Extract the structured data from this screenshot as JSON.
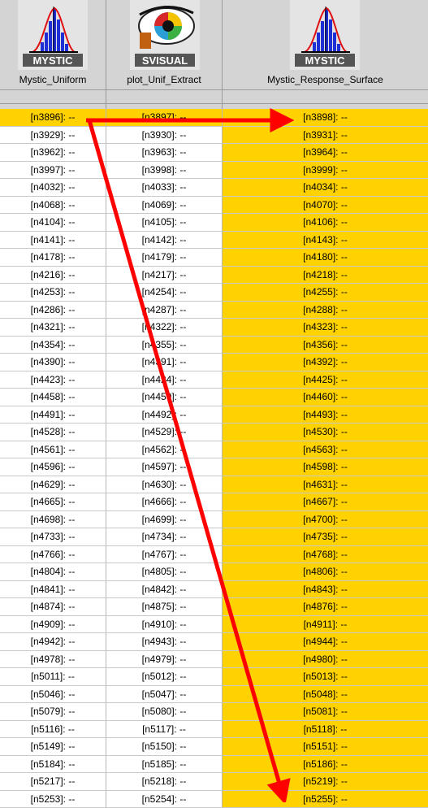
{
  "columns": [
    {
      "name": "Mystic_Uniform",
      "icon": "mystic-histogram-icon",
      "icon_label": "MYSTIC"
    },
    {
      "name": "plot_Unif_Extract",
      "icon": "visual-eye-icon",
      "icon_label": "SVISUAL"
    },
    {
      "name": "Mystic_Response_Surface",
      "icon": "mystic-histogram-icon",
      "icon_label": "MYSTIC"
    }
  ],
  "rows": [
    [
      "[n3896]: --",
      "[n3897]: --",
      "[n3898]: --"
    ],
    [
      "[n3929]: --",
      "[n3930]: --",
      "[n3931]: --"
    ],
    [
      "[n3962]: --",
      "[n3963]: --",
      "[n3964]: --"
    ],
    [
      "[n3997]: --",
      "[n3998]: --",
      "[n3999]: --"
    ],
    [
      "[n4032]: --",
      "[n4033]: --",
      "[n4034]: --"
    ],
    [
      "[n4068]: --",
      "[n4069]: --",
      "[n4070]: --"
    ],
    [
      "[n4104]: --",
      "[n4105]: --",
      "[n4106]: --"
    ],
    [
      "[n4141]: --",
      "[n4142]: --",
      "[n4143]: --"
    ],
    [
      "[n4178]: --",
      "[n4179]: --",
      "[n4180]: --"
    ],
    [
      "[n4216]: --",
      "[n4217]: --",
      "[n4218]: --"
    ],
    [
      "[n4253]: --",
      "[n4254]: --",
      "[n4255]: --"
    ],
    [
      "[n4286]: --",
      "[n4287]: --",
      "[n4288]: --"
    ],
    [
      "[n4321]: --",
      "[n4322]: --",
      "[n4323]: --"
    ],
    [
      "[n4354]: --",
      "[n4355]: --",
      "[n4356]: --"
    ],
    [
      "[n4390]: --",
      "[n4391]: --",
      "[n4392]: --"
    ],
    [
      "[n4423]: --",
      "[n4424]: --",
      "[n4425]: --"
    ],
    [
      "[n4458]: --",
      "[n4459]: --",
      "[n4460]: --"
    ],
    [
      "[n4491]: --",
      "[n4492]: --",
      "[n4493]: --"
    ],
    [
      "[n4528]: --",
      "[n4529]: --",
      "[n4530]: --"
    ],
    [
      "[n4561]: --",
      "[n4562]: --",
      "[n4563]: --"
    ],
    [
      "[n4596]: --",
      "[n4597]: --",
      "[n4598]: --"
    ],
    [
      "[n4629]: --",
      "[n4630]: --",
      "[n4631]: --"
    ],
    [
      "[n4665]: --",
      "[n4666]: --",
      "[n4667]: --"
    ],
    [
      "[n4698]: --",
      "[n4699]: --",
      "[n4700]: --"
    ],
    [
      "[n4733]: --",
      "[n4734]: --",
      "[n4735]: --"
    ],
    [
      "[n4766]: --",
      "[n4767]: --",
      "[n4768]: --"
    ],
    [
      "[n4804]: --",
      "[n4805]: --",
      "[n4806]: --"
    ],
    [
      "[n4841]: --",
      "[n4842]: --",
      "[n4843]: --"
    ],
    [
      "[n4874]: --",
      "[n4875]: --",
      "[n4876]: --"
    ],
    [
      "[n4909]: --",
      "[n4910]: --",
      "[n4911]: --"
    ],
    [
      "[n4942]: --",
      "[n4943]: --",
      "[n4944]: --"
    ],
    [
      "[n4978]: --",
      "[n4979]: --",
      "[n4980]: --"
    ],
    [
      "[n5011]: --",
      "[n5012]: --",
      "[n5013]: --"
    ],
    [
      "[n5046]: --",
      "[n5047]: --",
      "[n5048]: --"
    ],
    [
      "[n5079]: --",
      "[n5080]: --",
      "[n5081]: --"
    ],
    [
      "[n5116]: --",
      "[n5117]: --",
      "[n5118]: --"
    ],
    [
      "[n5149]: --",
      "[n5150]: --",
      "[n5151]: --"
    ],
    [
      "[n5184]: --",
      "[n5185]: --",
      "[n5186]: --"
    ],
    [
      "[n5217]: --",
      "[n5218]: --",
      "[n5219]: --"
    ],
    [
      "[n5253]: --",
      "[n5254]: --",
      "[n5255]: --"
    ]
  ],
  "colors": {
    "highlight": "#ffd200",
    "arrow": "#ff0000",
    "header_bg": "#d4d4d4"
  }
}
